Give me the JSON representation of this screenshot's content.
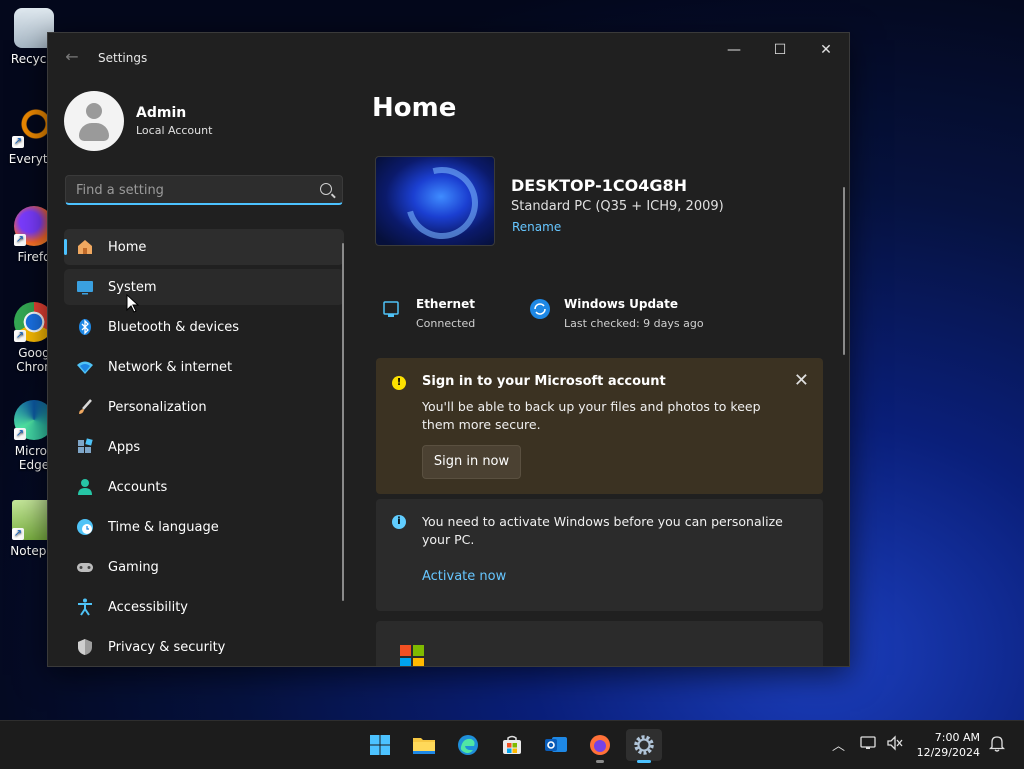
{
  "desktop": {
    "icons": [
      {
        "label": "Recycle",
        "icon": "recycle-bin-icon"
      },
      {
        "label": "Everyth",
        "icon": "everything-search-icon"
      },
      {
        "label": "Firefo",
        "icon": "firefox-icon"
      },
      {
        "label": "Googl\nChrom",
        "label1": "Goog",
        "label2": "Chron",
        "icon": "chrome-icon"
      },
      {
        "label1": "Micros",
        "label2": "Edge",
        "icon": "edge-icon"
      },
      {
        "label": "Notepa",
        "icon": "notepad-icon"
      }
    ]
  },
  "window": {
    "title": "Settings",
    "controls": {
      "minimize": "—",
      "maximize": "☐",
      "close": "✕"
    }
  },
  "sidebar": {
    "profile": {
      "name": "Admin",
      "account_type": "Local Account"
    },
    "search": {
      "placeholder": "Find a setting"
    },
    "items": [
      {
        "label": "Home",
        "icon": "home-icon"
      },
      {
        "label": "System",
        "icon": "system-icon"
      },
      {
        "label": "Bluetooth & devices",
        "icon": "bluetooth-icon"
      },
      {
        "label": "Network & internet",
        "icon": "network-icon"
      },
      {
        "label": "Personalization",
        "icon": "brush-icon"
      },
      {
        "label": "Apps",
        "icon": "apps-icon"
      },
      {
        "label": "Accounts",
        "icon": "accounts-icon"
      },
      {
        "label": "Time & language",
        "icon": "globe-clock-icon"
      },
      {
        "label": "Gaming",
        "icon": "gamepad-icon"
      },
      {
        "label": "Accessibility",
        "icon": "accessibility-icon"
      },
      {
        "label": "Privacy & security",
        "icon": "shield-icon"
      }
    ],
    "selected": "Home"
  },
  "main": {
    "title": "Home",
    "device": {
      "name": "DESKTOP-1CO4G8H",
      "model": "Standard PC (Q35 + ICH9, 2009)",
      "rename": "Rename"
    },
    "status": {
      "ethernet": {
        "title": "Ethernet",
        "sub": "Connected"
      },
      "update": {
        "title": "Windows Update",
        "sub": "Last checked: 9 days ago"
      }
    },
    "signin_card": {
      "title": "Sign in to your Microsoft account",
      "body": "You'll be able to back up your files and photos to keep them more secure.",
      "button": "Sign in now"
    },
    "activate_card": {
      "body": "You need to activate Windows before you can personalize your PC.",
      "link": "Activate now"
    }
  },
  "taskbar": {
    "apps": [
      {
        "name": "start-button"
      },
      {
        "name": "file-explorer"
      },
      {
        "name": "edge"
      },
      {
        "name": "microsoft-store"
      },
      {
        "name": "outlook-new"
      },
      {
        "name": "firefox"
      },
      {
        "name": "settings"
      }
    ],
    "clock": {
      "time": "7:00 AM",
      "date": "12/29/2024"
    }
  }
}
